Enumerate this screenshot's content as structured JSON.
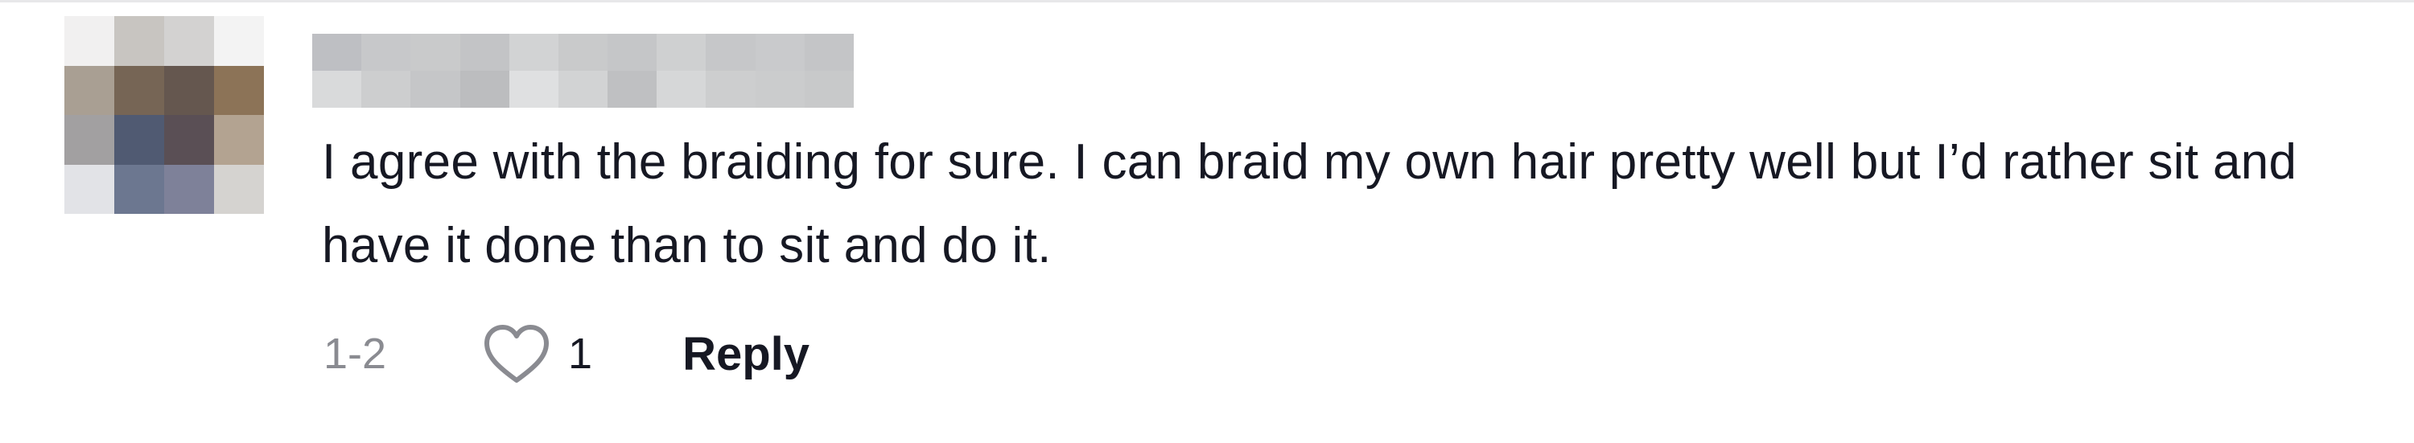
{
  "comment": {
    "username": "",
    "text": "I agree with the braiding for sure. I can braid my own hair pretty well but I’d rather sit and have it done than to sit and do it.",
    "timestamp": "1-2",
    "like_count": "1",
    "reply_label": "Reply"
  },
  "avatar": {
    "pixel_colors": [
      "#f1f0f0",
      "#c8c5c1",
      "#d3d2d1",
      "#f3f3f3",
      "#a99f93",
      "#766555",
      "#65574f",
      "#8c7357",
      "#a2a0a1",
      "#505a72",
      "#5a4f55",
      "#b3a391",
      "#e2e3e7",
      "#6c7790",
      "#7e8199",
      "#d5d3d0"
    ]
  },
  "username_pixels": {
    "colors": [
      "#bebfc3",
      "#c7c8ca",
      "#c9cacb",
      "#c3c4c6",
      "#d2d3d4",
      "#c9cacb",
      "#c5c6c8",
      "#cfd0d1",
      "#c6c7c9",
      "#c9cacc",
      "#c4c5c7",
      "#d9dadb",
      "#cdcecf",
      "#c5c6c8",
      "#bcbdbf",
      "#dfe0e1",
      "#d2d3d4",
      "#bfc0c2",
      "#d6d7d8",
      "#cdcecf",
      "#cbcccd",
      "#c8c9ca"
    ]
  },
  "colors": {
    "text_primary": "#161823",
    "text_secondary": "#8a8b91",
    "divider": "#e7e7e9"
  },
  "icons": {
    "like": "heart-outline-icon"
  }
}
